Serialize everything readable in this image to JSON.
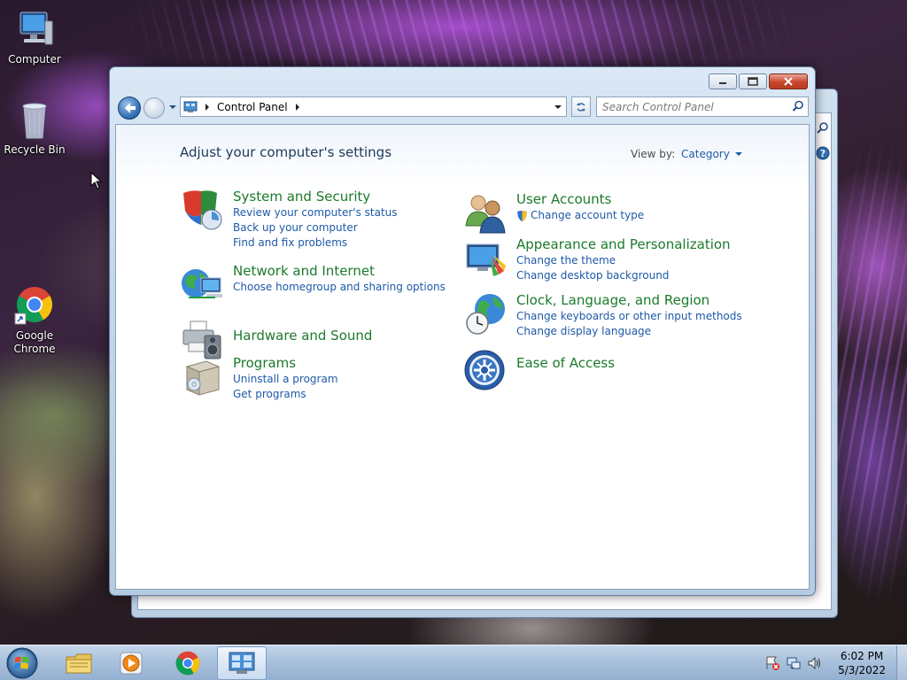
{
  "desktop": {
    "icons": [
      {
        "label": "Computer",
        "icon": "computer-icon"
      },
      {
        "label": "Recycle Bin",
        "icon": "recycle-bin-icon"
      },
      {
        "label": "Google Chrome",
        "icon": "chrome-icon"
      }
    ]
  },
  "window": {
    "address": {
      "crumb": "Control Panel"
    },
    "search": {
      "placeholder": "Search Control Panel"
    },
    "controls": {
      "minimize": "minimize-icon",
      "maximize": "maximize-icon",
      "close": "close-icon"
    }
  },
  "page": {
    "title": "Adjust your computer's settings",
    "view_by_label": "View by:",
    "view_by_value": "Category"
  },
  "categories": {
    "system": {
      "title": "System and Security",
      "links": [
        "Review your computer's status",
        "Back up your computer",
        "Find and fix problems"
      ]
    },
    "network": {
      "title": "Network and Internet",
      "links": [
        "Choose homegroup and sharing options"
      ]
    },
    "hardware": {
      "title": "Hardware and Sound",
      "links": []
    },
    "programs": {
      "title": "Programs",
      "links": [
        "Uninstall a program",
        "Get programs"
      ]
    },
    "users": {
      "title": "User Accounts",
      "links": [
        "Change account type"
      ]
    },
    "appearance": {
      "title": "Appearance and Personalization",
      "links": [
        "Change the theme",
        "Change desktop background"
      ]
    },
    "clock": {
      "title": "Clock, Language, and Region",
      "links": [
        "Change keyboards or other input methods",
        "Change display language"
      ]
    },
    "ease": {
      "title": "Ease of Access",
      "links": []
    }
  },
  "taskbar": {
    "items": [
      "start-orb-icon",
      "explorer-icon",
      "media-player-icon",
      "chrome-icon",
      "control-panel-icon"
    ],
    "clock": {
      "time": "6:02 PM",
      "date": "5/3/2022"
    }
  },
  "colors": {
    "category_title": "#1b7a2b",
    "link": "#1e5aa8",
    "heading": "#1e395b"
  }
}
